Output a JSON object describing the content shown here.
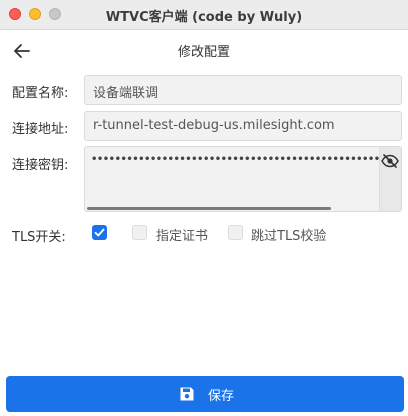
{
  "window": {
    "title": "WTVC客户端 (code by Wuly)"
  },
  "header": {
    "title": "修改配置"
  },
  "form": {
    "name_label": "配置名称:",
    "name_value": "设备端联调",
    "address_label": "连接地址:",
    "address_value": "r-tunnel-test-debug-us.milesight.com",
    "key_label": "连接密钥:",
    "key_masked": "••••••••••••••••••••••••••••••••••••••••••••••••••••••••••••••••••••••••••••",
    "tls_label": "TLS开关:",
    "tls_enabled": true,
    "cert_label": "指定证书",
    "cert_checked": false,
    "skip_verify_label": "跳过TLS校验",
    "skip_verify_checked": false
  },
  "footer": {
    "save_label": "保存"
  },
  "colors": {
    "accent": "#1a73e8"
  }
}
